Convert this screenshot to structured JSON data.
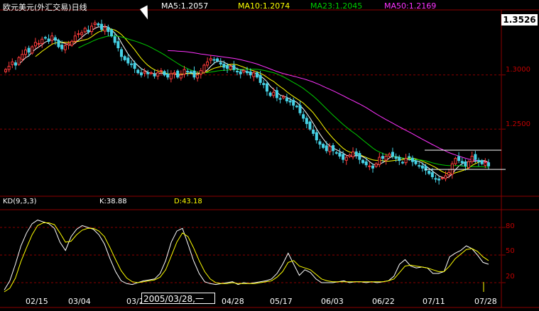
{
  "header": {
    "title": "欧元美元(外汇交易)日线",
    "ma5": "MA5:1.2057",
    "ma10": "MA10:1.2074",
    "ma23": "MA23:1.2045",
    "ma50": "MA50:1.2169"
  },
  "colors": {
    "background": "#000000",
    "grid": "#8b0000",
    "candle_up": "#ff3c3c",
    "candle_down": "#46d2e6",
    "ma5": "#ffffff",
    "ma10": "#ffff00",
    "ma23": "#00cc00",
    "ma50": "#ff33ff",
    "k_line": "#ffffff",
    "d_line": "#ffff00",
    "axis_label": "#c00000"
  },
  "price_box": "1.3526",
  "kd_header": {
    "title": "KD(9,3,3)",
    "k": "K:38.88",
    "d": "D:43.18"
  },
  "crosshair_label": "2005/03/28,一",
  "chart_data": [
    {
      "type": "candlestick",
      "title": "欧元美元(外汇交易)日线",
      "y_ticks": [
        "1.3000",
        "1.2500"
      ],
      "ylim": [
        1.19,
        1.36
      ],
      "x_ticks": [
        "02/15",
        "03/04",
        "03/2",
        "04/28",
        "05/17",
        "06/03",
        "06/22",
        "07/11",
        "07/28"
      ],
      "legend": [
        "MA5:1.2057",
        "MA10:1.2074",
        "MA23:1.2045",
        "MA50:1.2169"
      ],
      "annotation_levels": [
        1.2305,
        1.2128
      ],
      "close": [
        1.305,
        1.308,
        1.312,
        1.309,
        1.316,
        1.319,
        1.323,
        1.321,
        1.326,
        1.33,
        1.329,
        1.333,
        1.334,
        1.331,
        1.336,
        1.332,
        1.326,
        1.324,
        1.327,
        1.329,
        1.331,
        1.336,
        1.338,
        1.339,
        1.343,
        1.34,
        1.345,
        1.348,
        1.346,
        1.342,
        1.344,
        1.34,
        1.336,
        1.33,
        1.325,
        1.317,
        1.314,
        1.311,
        1.31,
        1.306,
        1.302,
        1.3,
        1.303,
        1.301,
        1.302,
        1.299,
        1.302,
        1.304,
        1.3,
        1.298,
        1.301,
        1.302,
        1.298,
        1.3,
        1.305,
        1.303,
        1.302,
        1.298,
        1.3,
        1.304,
        1.309,
        1.312,
        1.315,
        1.314,
        1.313,
        1.31,
        1.307,
        1.306,
        1.308,
        1.305,
        1.303,
        1.301,
        1.304,
        1.302,
        1.3,
        1.302,
        1.298,
        1.293,
        1.291,
        1.285,
        1.281,
        1.284,
        1.279,
        1.278,
        1.28,
        1.276,
        1.275,
        1.272,
        1.271,
        1.265,
        1.26,
        1.255,
        1.25,
        1.246,
        1.24,
        1.236,
        1.233,
        1.23,
        1.234,
        1.23,
        1.228,
        1.225,
        1.222,
        1.224,
        1.226,
        1.229,
        1.226,
        1.222,
        1.219,
        1.217,
        1.216,
        1.214,
        1.218,
        1.224,
        1.223,
        1.225,
        1.227,
        1.225,
        1.223,
        1.221,
        1.219,
        1.223,
        1.224,
        1.22,
        1.218,
        1.216,
        1.214,
        1.212,
        1.209,
        1.206,
        1.204,
        1.203,
        1.205,
        1.207,
        1.21,
        1.218,
        1.223,
        1.221,
        1.219,
        1.216,
        1.22,
        1.225,
        1.222,
        1.22,
        1.218,
        1.219,
        1.216
      ]
    },
    {
      "type": "line",
      "title": "KD(9,3,3)",
      "ylim": [
        10,
        100
      ],
      "y_ticks": [
        80,
        50,
        20
      ],
      "series": [
        {
          "name": "K",
          "values": [
            12,
            22,
            40,
            60,
            74,
            84,
            88,
            86,
            84,
            79,
            64,
            55,
            70,
            78,
            82,
            80,
            78,
            72,
            62,
            46,
            32,
            22,
            19,
            18,
            20,
            22,
            23,
            24,
            30,
            44,
            64,
            76,
            79,
            62,
            44,
            30,
            21,
            19,
            18,
            19,
            20,
            21,
            18,
            20,
            19,
            20,
            21,
            22,
            24,
            30,
            40,
            52,
            40,
            28,
            34,
            31,
            24,
            20,
            20,
            20,
            21,
            22,
            20,
            21,
            21,
            20,
            21,
            20,
            21,
            22,
            27,
            40,
            45,
            38,
            36,
            37,
            36,
            30,
            30,
            32,
            48,
            52,
            55,
            60,
            57,
            50,
            42,
            40
          ]
        },
        {
          "name": "D",
          "values": [
            10,
            14,
            25,
            43,
            58,
            72,
            82,
            85,
            85,
            83,
            74,
            64,
            65,
            72,
            77,
            79,
            79,
            76,
            70,
            58,
            45,
            33,
            25,
            21,
            20,
            21,
            22,
            23,
            26,
            34,
            49,
            64,
            74,
            70,
            58,
            44,
            32,
            24,
            20,
            19,
            19,
            20,
            19,
            19,
            19,
            19,
            20,
            21,
            22,
            26,
            32,
            42,
            44,
            38,
            36,
            34,
            29,
            24,
            22,
            21,
            21,
            21,
            21,
            21,
            21,
            21,
            21,
            21,
            21,
            22,
            24,
            31,
            38,
            39,
            38,
            37,
            36,
            34,
            32,
            32,
            38,
            46,
            51,
            56,
            57,
            54,
            48,
            44
          ]
        }
      ]
    }
  ]
}
